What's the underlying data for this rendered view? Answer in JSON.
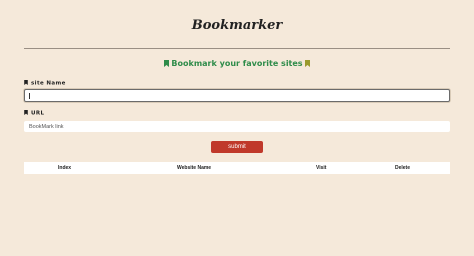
{
  "header": {
    "logo_text": "Bookmarker"
  },
  "form": {
    "subtitle": "Bookmark your favorite sites",
    "site_name_label": "site Name",
    "site_name_value": "",
    "url_label": "URL",
    "url_placeholder": "BookMark link",
    "submit_label": "submit"
  },
  "table": {
    "headers": [
      "Index",
      "Website Name",
      "Visit",
      "Delete"
    ]
  },
  "colors": {
    "background": "#f5e9da",
    "submit": "#c0392b",
    "subtitle_green": "#2f8c4a",
    "subtitle_olive": "#9a9a2c",
    "logo_highlight": "#f2b84b"
  },
  "icons": [
    "bookmark-icon"
  ]
}
